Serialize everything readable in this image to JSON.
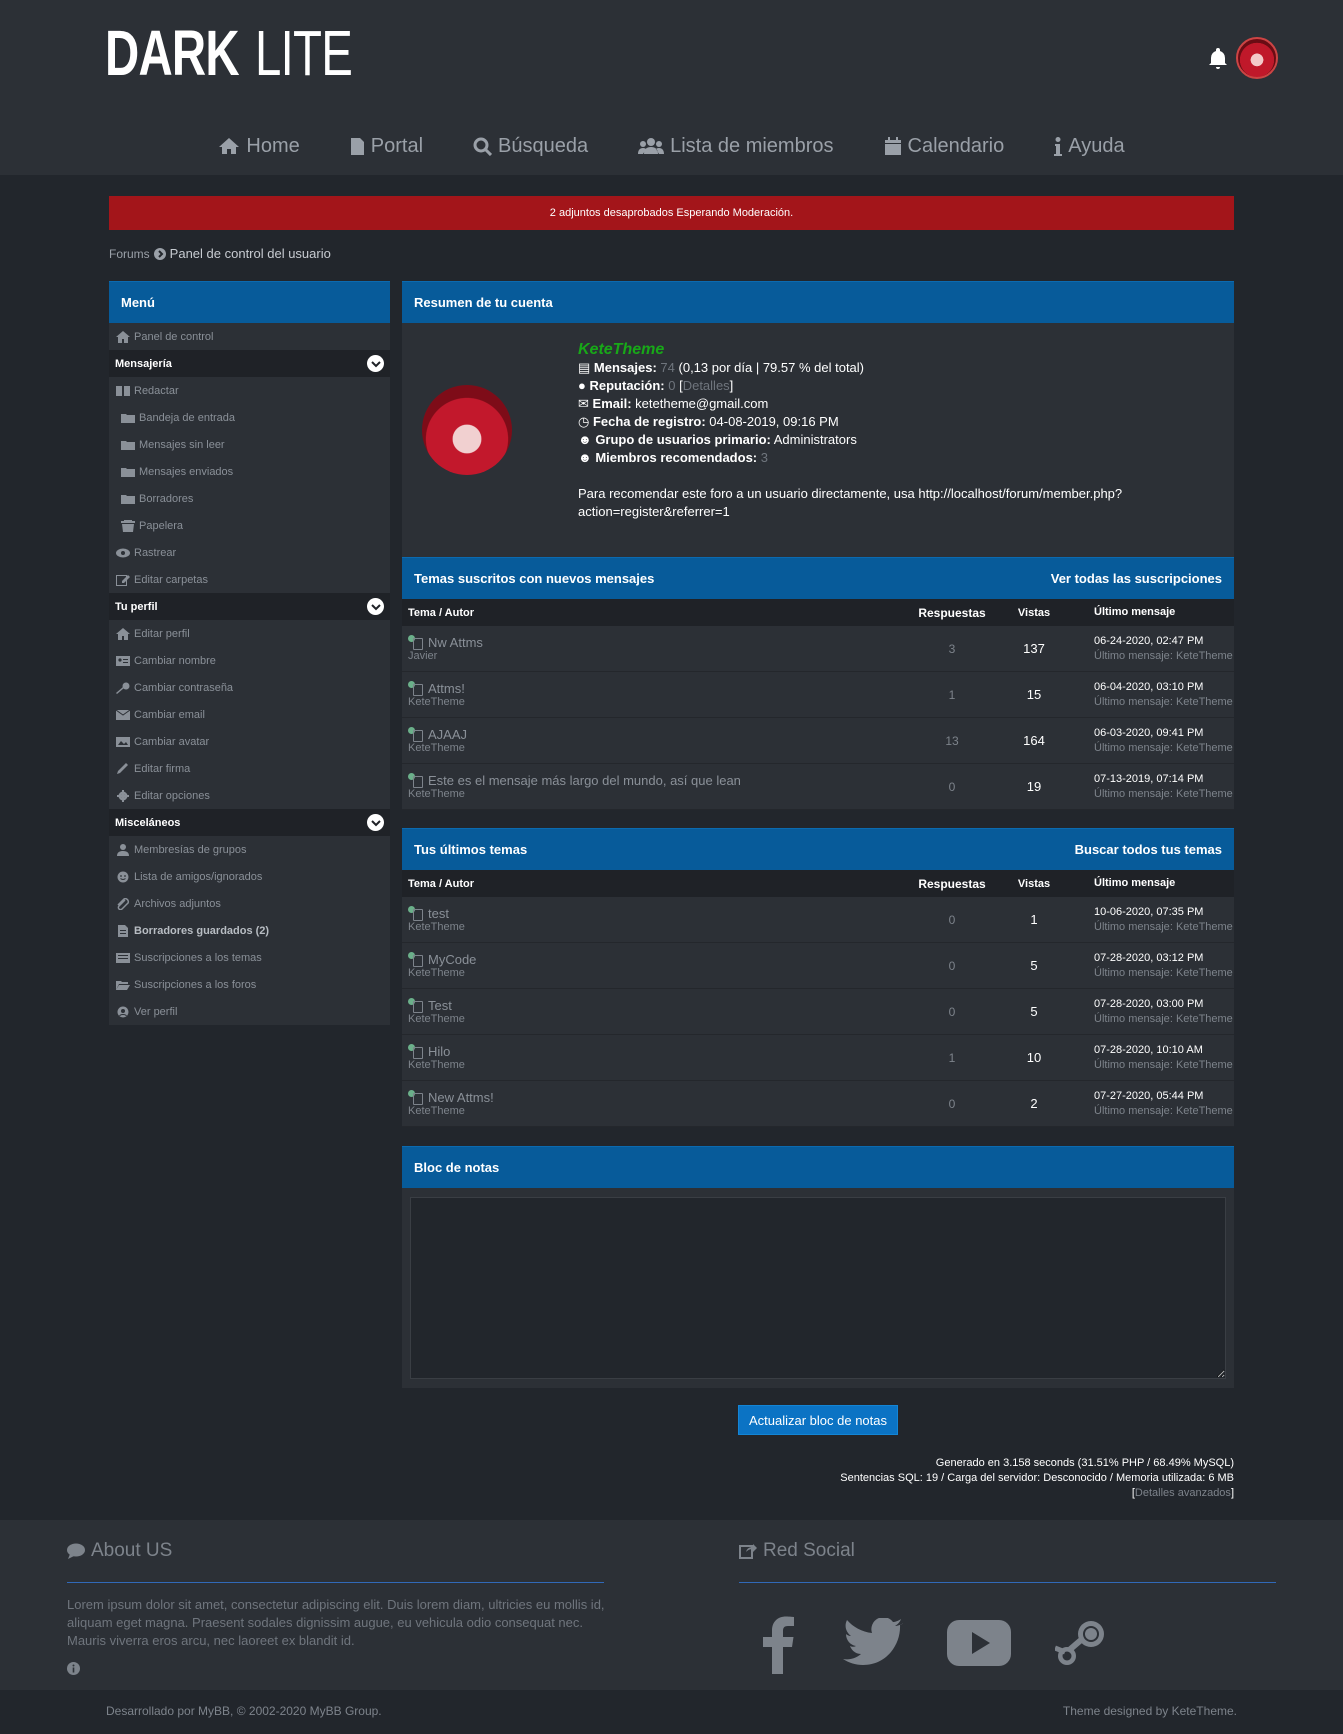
{
  "header": {
    "logo_bold": "DARK",
    "logo_light": "LITE"
  },
  "nav": [
    {
      "label": "Home",
      "icon": "home-icon"
    },
    {
      "label": "Portal",
      "icon": "file-icon"
    },
    {
      "label": "Búsqueda",
      "icon": "search-icon"
    },
    {
      "label": "Lista de miembros",
      "icon": "users-icon"
    },
    {
      "label": "Calendario",
      "icon": "calendar-icon"
    },
    {
      "label": "Ayuda",
      "icon": "info-icon"
    }
  ],
  "alert": "2 adjuntos desaprobados Esperando Moderación.",
  "breadcrumb": {
    "root": "Forums",
    "current": "Panel de control del usuario"
  },
  "sidebar": {
    "title": "Menú",
    "home": "Panel de control",
    "sections": [
      {
        "title": "Mensajería",
        "items": [
          "Redactar",
          "Bandeja de entrada",
          "Mensajes sin leer",
          "Mensajes enviados",
          "Borradores",
          "Papelera",
          "Rastrear",
          "Editar carpetas"
        ]
      },
      {
        "title": "Tu perfil",
        "items": [
          "Editar perfil",
          "Cambiar nombre",
          "Cambiar contraseña",
          "Cambiar email",
          "Cambiar avatar",
          "Editar firma",
          "Editar opciones"
        ]
      },
      {
        "title": "Misceláneos",
        "items": [
          "Membresías de grupos",
          "Lista de amigos/ignorados",
          "Archivos adjuntos",
          "Borradores guardados (2)",
          "Suscripciones a los temas",
          "Suscripciones a los foros",
          "Ver perfil"
        ]
      }
    ]
  },
  "summary": {
    "title": "Resumen de tu cuenta",
    "username": "KeteTheme",
    "posts_label": "Mensajes:",
    "posts": "74",
    "posts_extra": "(0,13 por día | 79.57 % del total)",
    "rep_label": "Reputación:",
    "rep": "0",
    "rep_details": "Detalles",
    "email_label": "Email:",
    "email": "ketetheme@gmail.com",
    "reg_label": "Fecha de registro:",
    "reg": "04-08-2019, 09:16 PM",
    "group_label": "Grupo de usuarios primario:",
    "group": "Administrators",
    "ref_label": "Miembros recomendados:",
    "ref": "3",
    "referral_line1": "Para recomendar este foro a un usuario directamente, usa http://localhost/forum/member.php?",
    "referral_line2": "action=register&referrer=1"
  },
  "subscribed": {
    "title": "Temas suscritos con nuevos mensajes",
    "link": "Ver todas las suscripciones",
    "cols": [
      "Tema / Autor",
      "Respuestas",
      "Vistas",
      "Último mensaje"
    ],
    "rows": [
      {
        "title": "Nw Attms",
        "author": "Javier",
        "replies": "3",
        "views": "137",
        "date": "06-24-2020, 02:47 PM",
        "last_label": "Último mensaje",
        "last_by": "KeteTheme"
      },
      {
        "title": "Attms!",
        "author": "KeteTheme",
        "replies": "1",
        "views": "15",
        "date": "06-04-2020, 03:10 PM",
        "last_label": "Último mensaje",
        "last_by": "KeteTheme"
      },
      {
        "title": "AJAAJ",
        "author": "KeteTheme",
        "replies": "13",
        "views": "164",
        "date": "06-03-2020, 09:41 PM",
        "last_label": "Último mensaje",
        "last_by": "KeteTheme"
      },
      {
        "title": "Este es el mensaje más largo del mundo, así que lean",
        "author": "KeteTheme",
        "replies": "0",
        "views": "19",
        "date": "07-13-2019, 07:14 PM",
        "last_label": "Último mensaje",
        "last_by": "KeteTheme"
      }
    ]
  },
  "latest": {
    "title": "Tus últimos temas",
    "link": "Buscar todos tus temas",
    "cols": [
      "Tema / Autor",
      "Respuestas",
      "Vistas",
      "Último mensaje"
    ],
    "rows": [
      {
        "title": "test",
        "author": "KeteTheme",
        "replies": "0",
        "views": "1",
        "date": "10-06-2020, 07:35 PM",
        "last_label": "Último mensaje",
        "last_by": "KeteTheme"
      },
      {
        "title": "MyCode",
        "author": "KeteTheme",
        "replies": "0",
        "views": "5",
        "date": "07-28-2020, 03:12 PM",
        "last_label": "Último mensaje",
        "last_by": "KeteTheme"
      },
      {
        "title": "Test",
        "author": "KeteTheme",
        "replies": "0",
        "views": "5",
        "date": "07-28-2020, 03:00 PM",
        "last_label": "Último mensaje",
        "last_by": "KeteTheme"
      },
      {
        "title": "Hilo",
        "author": "KeteTheme",
        "replies": "1",
        "views": "10",
        "date": "07-28-2020, 10:10 AM",
        "last_label": "Último mensaje",
        "last_by": "KeteTheme"
      },
      {
        "title": "New Attms!",
        "author": "KeteTheme",
        "replies": "0",
        "views": "2",
        "date": "07-27-2020, 05:44 PM",
        "last_label": "Último mensaje",
        "last_by": "KeteTheme"
      }
    ]
  },
  "notes": {
    "title": "Bloc de notas",
    "value": "",
    "button": "Actualizar bloc de notas"
  },
  "stats": {
    "line1": "Generado en 3.158 seconds (31.51% PHP / 68.49% MySQL)",
    "line2": "Sentencias SQL: 19 / Carga del servidor: Desconocido / Memoria utilizada: 6 MB",
    "details": "Detalles avanzados"
  },
  "footer": {
    "about_title": "About US",
    "about_text": "Lorem ipsum dolor sit amet, consectetur adipiscing elit. Duis lorem diam, ultricies eu mollis id, aliquam eget magna. Praesent sodales dignissim augue, eu vehicula odio consequat nec. Mauris viverra eros arcu, nec laoreet ex blandit id.",
    "social_title": "Red Social",
    "copyright": "Desarrollado por MyBB, © 2002-2020 MyBB Group.",
    "credit": "Theme designed by KeteTheme."
  },
  "colors": {
    "accent": "#075b9a",
    "alert": "#a3151a",
    "username": "#18a818"
  }
}
